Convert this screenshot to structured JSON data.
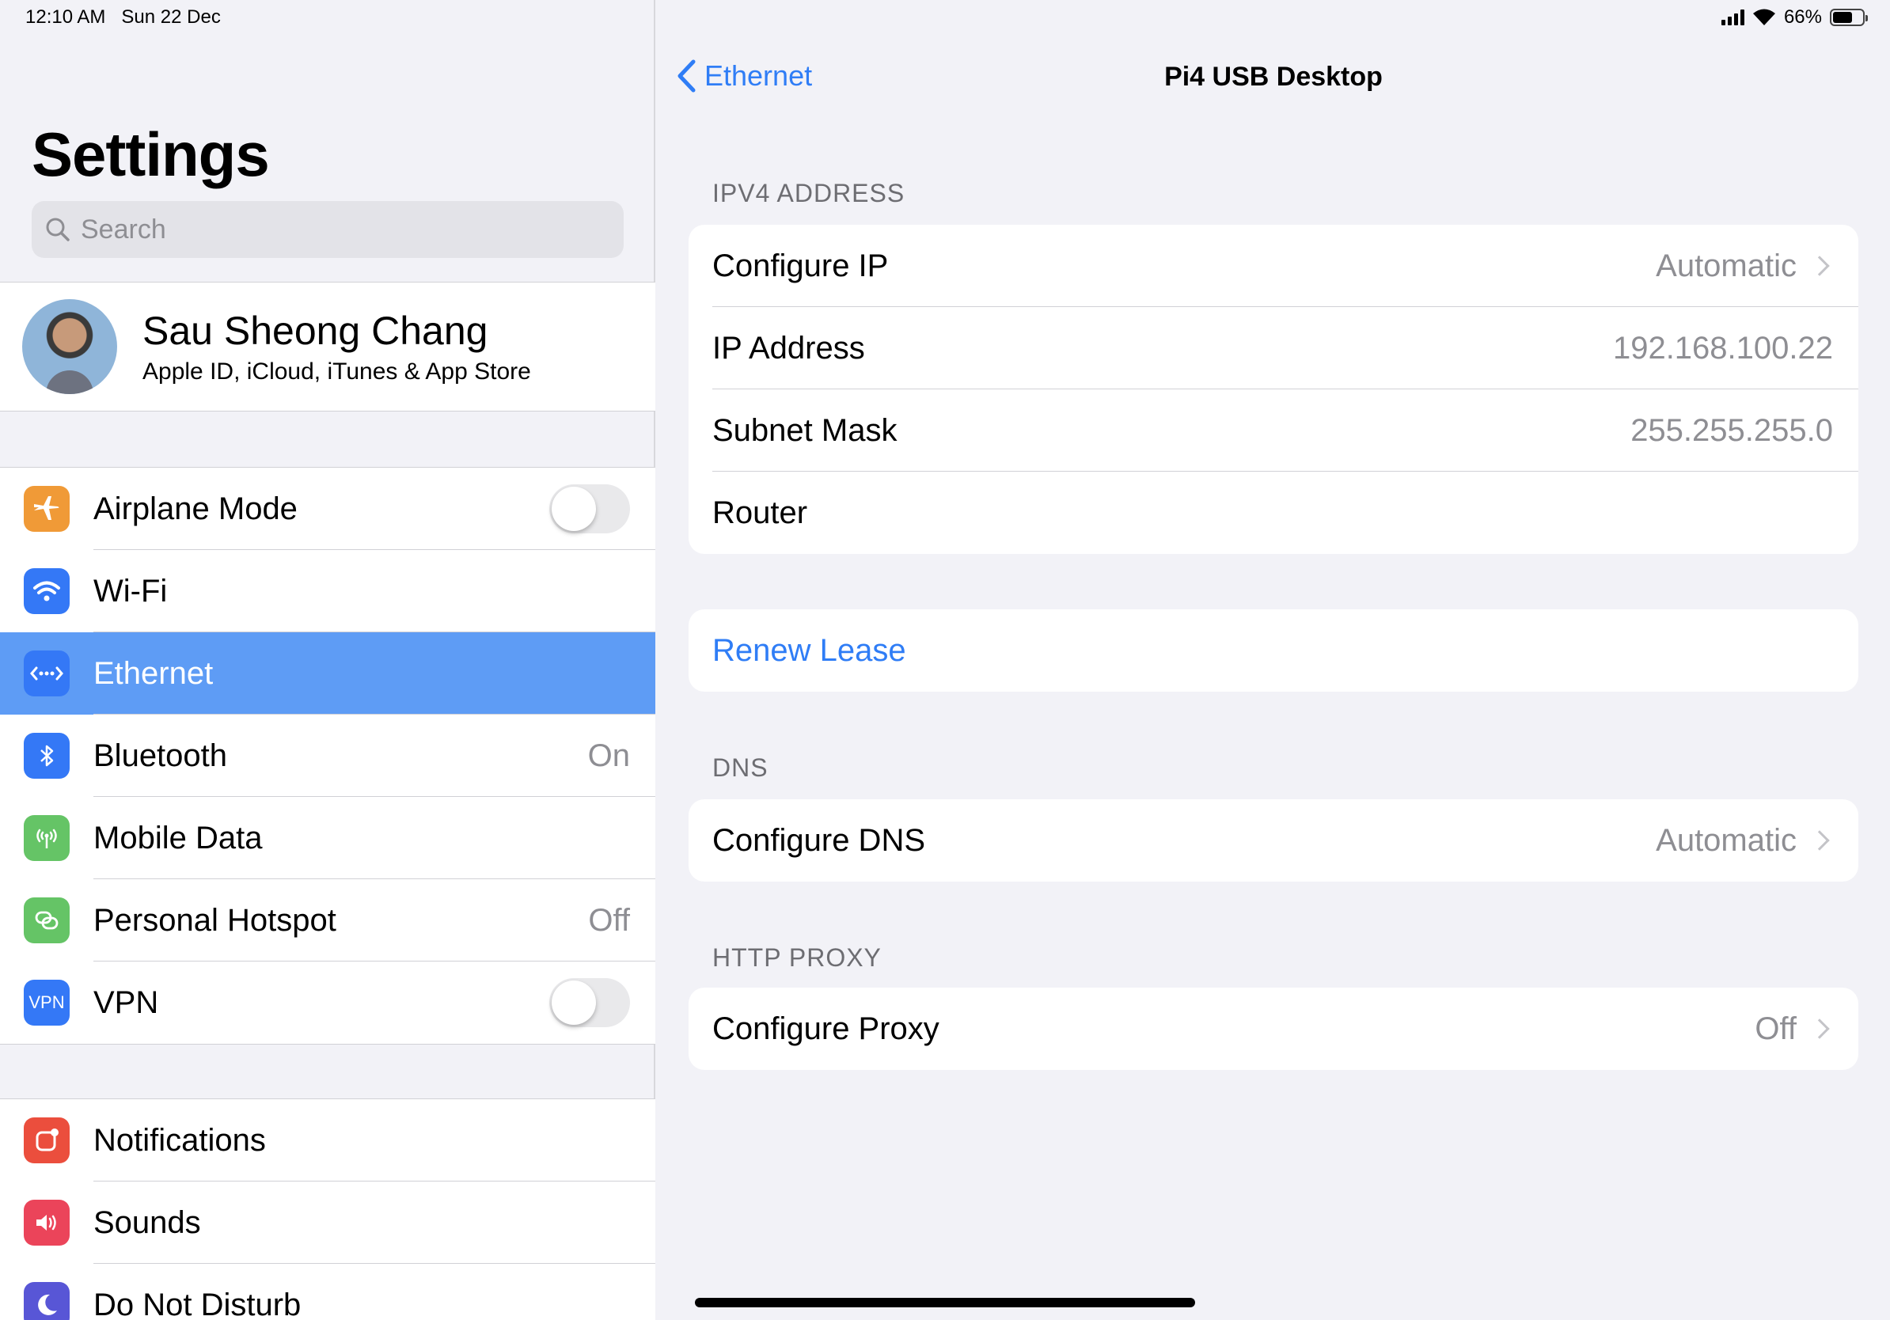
{
  "status": {
    "time": "12:10 AM",
    "date": "Sun 22 Dec",
    "battery": "66%",
    "battery_level": 0.66
  },
  "sidebar": {
    "title": "Settings",
    "search_placeholder": "Search",
    "profile": {
      "name": "Sau Sheong Chang",
      "subtitle": "Apple ID, iCloud, iTunes & App Store"
    },
    "groups": [
      [
        {
          "label": "Airplane Mode",
          "icon": "airplane-icon",
          "color": "#f09a37",
          "toggle": false
        },
        {
          "label": "Wi-Fi",
          "icon": "wifi-icon",
          "color": "#3478f6",
          "value": ""
        },
        {
          "label": "Ethernet",
          "icon": "ethernet-icon",
          "color": "#3478f6",
          "value": "",
          "selected": true
        },
        {
          "label": "Bluetooth",
          "icon": "bluetooth-icon",
          "color": "#3478f6",
          "value": "On"
        },
        {
          "label": "Mobile Data",
          "icon": "antenna-icon",
          "color": "#65c466",
          "value": ""
        },
        {
          "label": "Personal Hotspot",
          "icon": "hotspot-icon",
          "color": "#65c466",
          "value": "Off"
        },
        {
          "label": "VPN",
          "icon": "vpn-icon",
          "color": "#3478f6",
          "toggle": false
        }
      ],
      [
        {
          "label": "Notifications",
          "icon": "notifications-icon",
          "color": "#eb4e3d"
        },
        {
          "label": "Sounds",
          "icon": "speaker-icon",
          "color": "#eb445a"
        },
        {
          "label": "Do Not Disturb",
          "icon": "moon-icon",
          "color": "#5856d6"
        }
      ]
    ]
  },
  "detail": {
    "back_label": "Ethernet",
    "title": "Pi4 USB Desktop",
    "ipv4_header": "IPV4 ADDRESS",
    "ipv4": {
      "configure_ip_label": "Configure IP",
      "configure_ip_value": "Automatic",
      "ip_address_label": "IP Address",
      "ip_address_value": "192.168.100.22",
      "subnet_mask_label": "Subnet Mask",
      "subnet_mask_value": "255.255.255.0",
      "router_label": "Router"
    },
    "renew_lease": "Renew Lease",
    "dns_header": "DNS",
    "configure_dns_label": "Configure DNS",
    "configure_dns_value": "Automatic",
    "proxy_header": "HTTP PROXY",
    "configure_proxy_label": "Configure Proxy",
    "configure_proxy_value": "Off"
  }
}
